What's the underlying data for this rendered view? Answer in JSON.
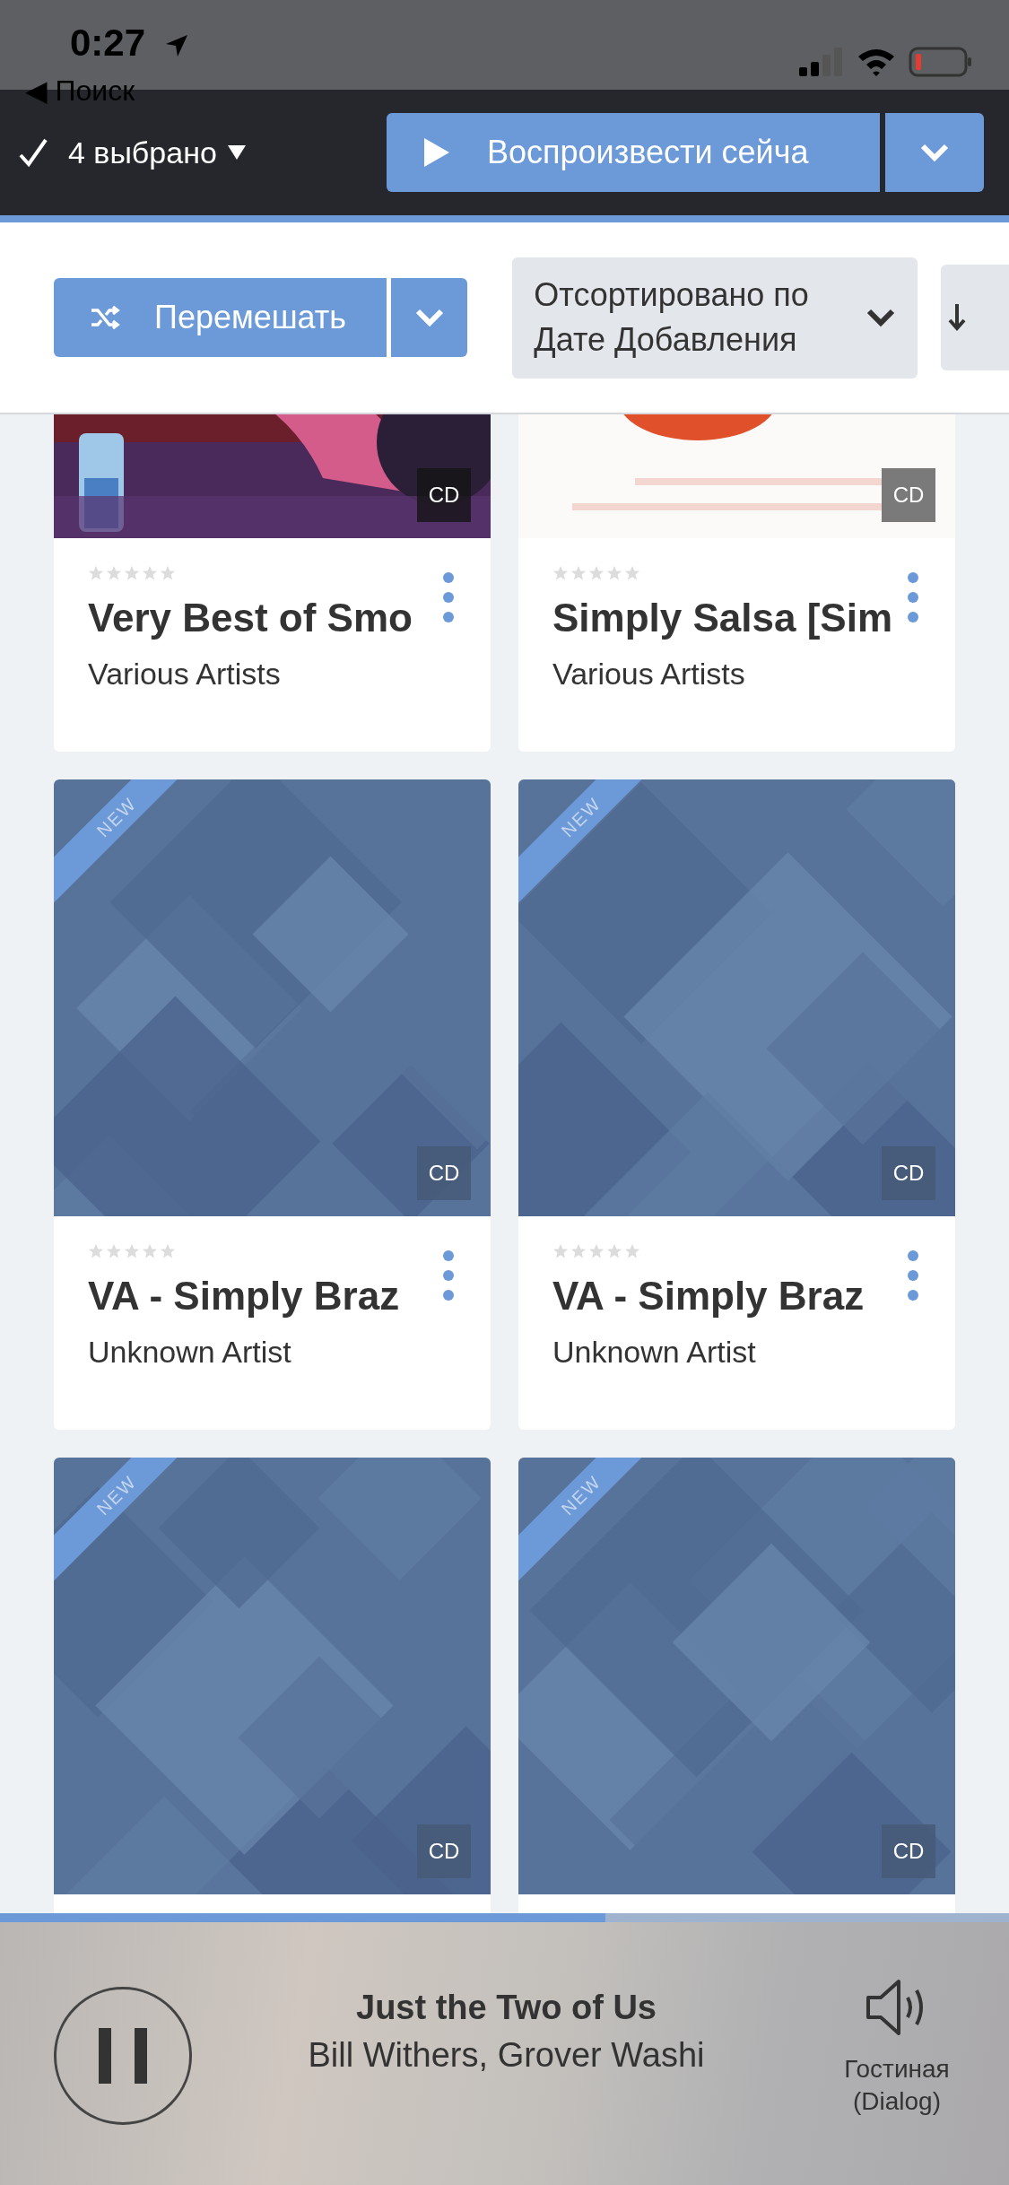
{
  "status_bar": {
    "time": "0:27",
    "back_link": "◀ Поиск"
  },
  "selection": {
    "label": "4 выбрано"
  },
  "play_button": {
    "label": "Воспроизвести сейча"
  },
  "shuffle_button": {
    "label": "Перемешать"
  },
  "sort": {
    "label": "Отсортировано по Дате Добавления"
  },
  "albums": [
    {
      "kind": "picture",
      "format": "CD",
      "stars": 0,
      "title": "Very Best of Smo",
      "artist": "Various Artists"
    },
    {
      "kind": "picture",
      "format": "CD",
      "stars": 0,
      "title": "Simply Salsa [Sim",
      "artist": "Various Artists"
    },
    {
      "kind": "pattern",
      "badge": "NEW",
      "format": "CD",
      "stars": 0,
      "title": "VA - Simply Braz",
      "artist": "Unknown Artist"
    },
    {
      "kind": "pattern",
      "badge": "NEW",
      "format": "CD",
      "stars": 0,
      "title": "VA - Simply Braz",
      "artist": "Unknown Artist"
    },
    {
      "kind": "pattern",
      "badge": "NEW",
      "format": "CD"
    },
    {
      "kind": "pattern",
      "badge": "NEW",
      "format": "CD"
    }
  ],
  "player": {
    "playing": true,
    "level": 0.6,
    "title": "Just the Two of Us",
    "artist": "Bill Withers, Grover Washi",
    "output": "Гостиная (Dialog)"
  }
}
